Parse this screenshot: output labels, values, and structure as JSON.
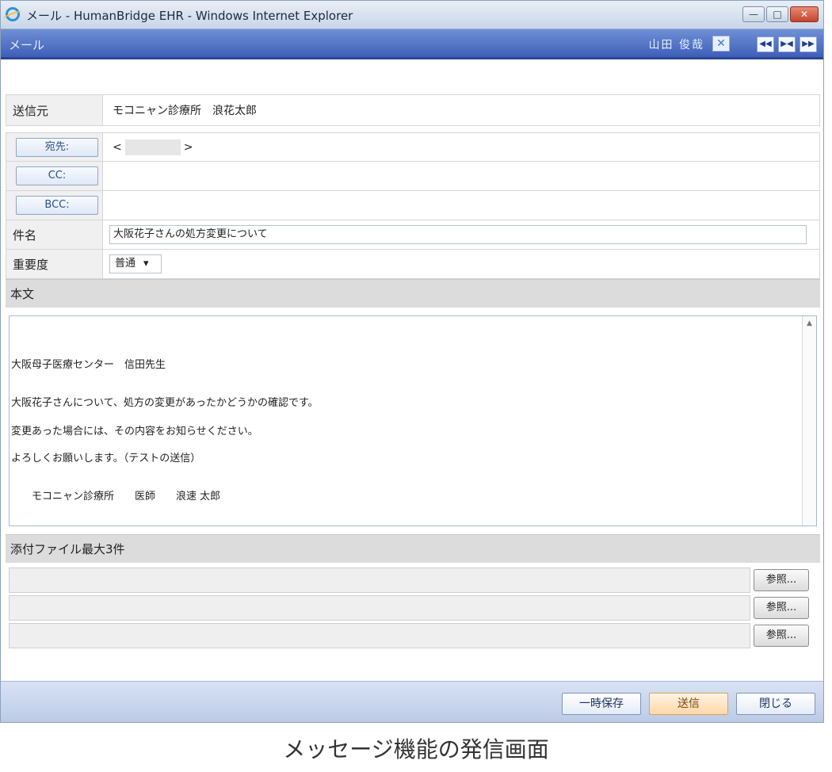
{
  "window": {
    "title": "メール - HumanBridge EHR - Windows Internet Explorer",
    "controls": {
      "minimize": "—",
      "maximize": "□",
      "close": "✕"
    }
  },
  "appbar": {
    "title": "メール",
    "user": "山田 俊哉",
    "logout_icon": "✕",
    "nav": [
      "◀◀",
      "▶◀",
      "▶▶"
    ]
  },
  "form": {
    "from_label": "送信元",
    "from_value": "モコニャン診療所　浪花太郎",
    "to_button": "宛先:",
    "to_value_prefix": "<",
    "to_value_suffix": ">",
    "cc_button": "CC:",
    "bcc_button": "BCC:",
    "subject_label": "件名",
    "subject_value": "大阪花子さんの処方変更について",
    "priority_label": "重要度",
    "priority_value": "普通",
    "priority_arrow": "▾"
  },
  "body": {
    "label": "本文",
    "lines": [
      "大阪母子医療センター　信田先生",
      "大阪花子さんについて、処方の変更があったかどうかの確認です。",
      "変更あった場合には、その内容をお知らせください。",
      "よろしくお願いします。（テストの送信）",
      "　　モコニャン診療所　　医師　　浪速 太郎"
    ],
    "scroll_arrow": "▲"
  },
  "attachments": {
    "label": "添付ファイル最大3件",
    "browse_labels": [
      "参照...",
      "参照...",
      "参照..."
    ]
  },
  "footer": {
    "save_draft": "一時保存",
    "send": "送信",
    "close": "閉じる"
  },
  "caption": "メッセージ機能の発信画面"
}
